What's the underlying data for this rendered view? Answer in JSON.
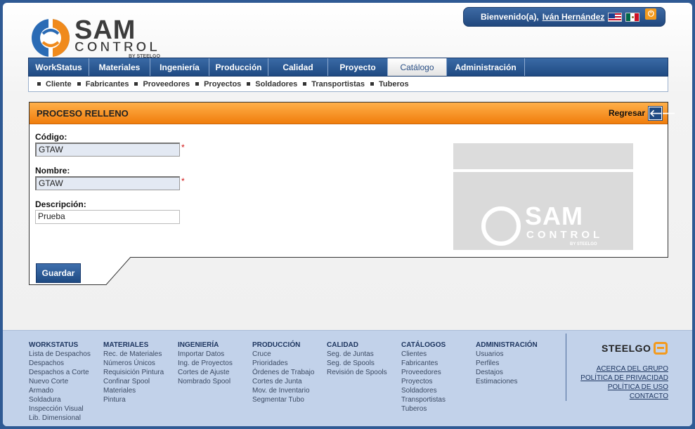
{
  "header": {
    "welcome_text": "Bienvenido(a),",
    "user_name": "Iván Hernández",
    "logo_sam": "SAM",
    "logo_control": "CONTROL",
    "logo_by": "BY STEELGO"
  },
  "nav": {
    "items": [
      {
        "label": "WorkStatus"
      },
      {
        "label": "Materiales"
      },
      {
        "label": "Ingeniería"
      },
      {
        "label": "Producción"
      },
      {
        "label": "Calidad"
      },
      {
        "label": "Proyecto"
      },
      {
        "label": "Catálogo"
      },
      {
        "label": "Administración"
      }
    ],
    "active": "Catálogo"
  },
  "subnav": {
    "items": [
      "Cliente",
      "Fabricantes",
      "Proveedores",
      "Proyectos",
      "Soldadores",
      "Transportistas",
      "Tuberos"
    ]
  },
  "panel": {
    "title": "PROCESO RELLENO",
    "back_label": "Regresar",
    "fields": {
      "codigo": {
        "label": "Código:",
        "value": "GTAW",
        "required": "*"
      },
      "nombre": {
        "label": "Nombre:",
        "value": "GTAW",
        "required": "*"
      },
      "descripcion": {
        "label": "Descripción:",
        "value": "Prueba"
      }
    },
    "watermark": {
      "sam": "SAM",
      "control": "CONTROL",
      "by": "BY STEELGO"
    }
  },
  "actions": {
    "save_label": "Guardar"
  },
  "footer": {
    "columns": [
      {
        "title": "WORKSTATUS",
        "links": [
          "Lista de Despachos",
          "Despachos",
          "Despachos a Corte",
          "Nuevo Corte",
          "Armado",
          "Soldadura",
          "Inspección Visual",
          "Lib. Dimensional"
        ]
      },
      {
        "title": "MATERIALES",
        "links": [
          "Rec. de Materiales",
          "Números Únicos",
          "Requisición Pintura",
          "Confinar Spool",
          "Materiales",
          "Pintura"
        ]
      },
      {
        "title": "INGENIERÍA",
        "links": [
          "Importar Datos",
          "Ing. de Proyectos",
          "Cortes de Ajuste",
          "Nombrado Spool"
        ]
      },
      {
        "title": "PRODUCCIÓN",
        "links": [
          "Cruce",
          "Prioridades",
          "Órdenes de Trabajo",
          "Cortes de Junta",
          "Mov. de Inventario",
          "Segmentar Tubo"
        ]
      },
      {
        "title": "CALIDAD",
        "links": [
          "Seg. de Juntas",
          "Seg. de Spools",
          "Revisión de Spools"
        ]
      },
      {
        "title": "CATÁLOGOS",
        "links": [
          "Clientes",
          "Fabricantes",
          "Proveedores",
          "Proyectos",
          "Soldadores",
          "Transportistas",
          "Tuberos"
        ]
      },
      {
        "title": "ADMINISTRACIÓN",
        "links": [
          "Usuarios",
          "Perfiles",
          "Destajos",
          "Estimaciones"
        ]
      }
    ],
    "brand": "STEELGO",
    "links": [
      "ACERCA DEL GRUPO",
      "POLÍTICA DE PRIVACIDAD",
      "POLÍTICA DE USO",
      "CONTACTO"
    ]
  },
  "colors": {
    "accent_orange": "#f07d0c",
    "nav_blue": "#1f4a82",
    "footer_bg": "#c2d2ea"
  }
}
